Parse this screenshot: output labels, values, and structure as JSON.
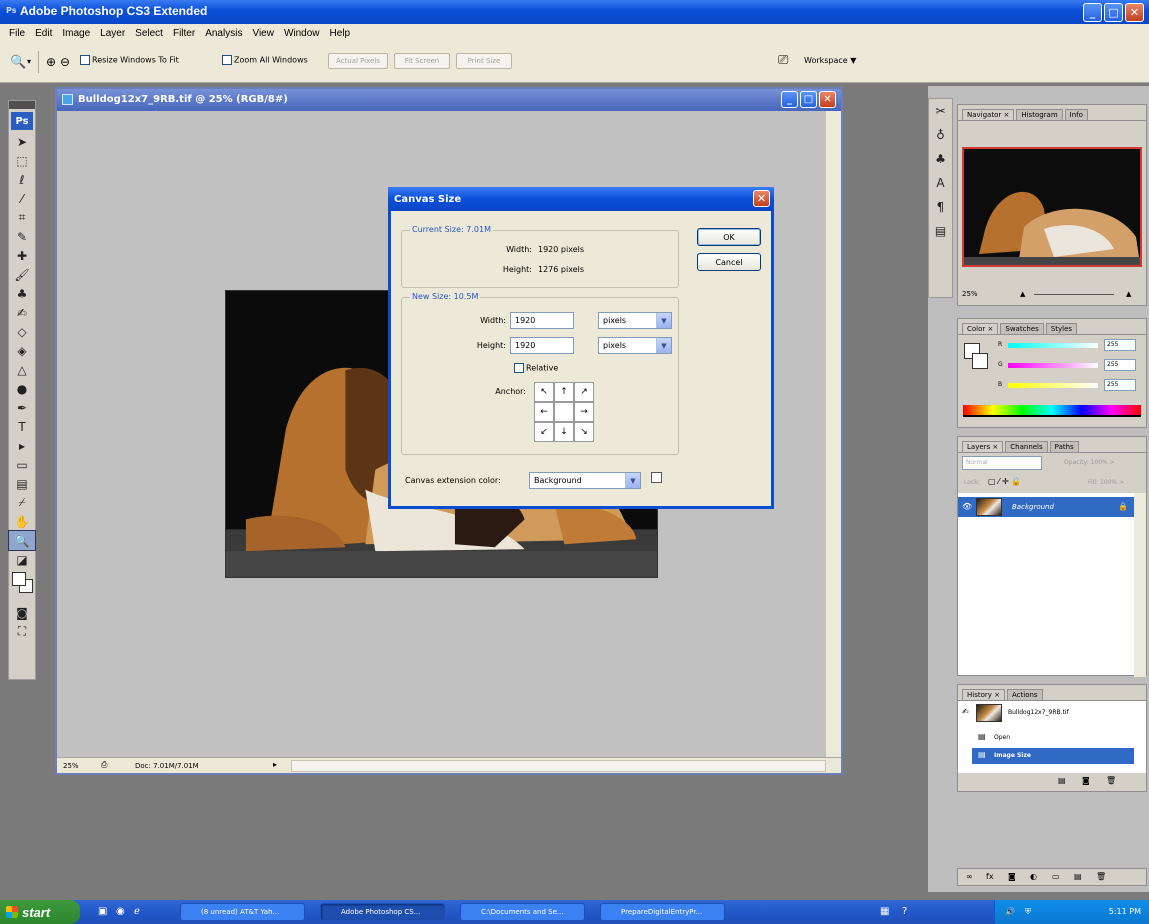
{
  "window": {
    "title": "Adobe Photoshop CS3 Extended",
    "min": "_",
    "max": "□",
    "close": "✕"
  },
  "menu": [
    "File",
    "Edit",
    "Image",
    "Layer",
    "Select",
    "Filter",
    "Analysis",
    "View",
    "Window",
    "Help"
  ],
  "options": {
    "resize_windows": "Resize Windows To Fit",
    "zoom_all": "Zoom All Windows",
    "actual_pixels": "Actual Pixels",
    "fit_screen": "Fit Screen",
    "print_size": "Print Size",
    "workspace": "Workspace ▼"
  },
  "document": {
    "title": "Bulldog12x7_9RB.tif @ 25% (RGB/8#)",
    "zoom": "25%",
    "doc_info": "Doc: 7.01M/7.01M"
  },
  "dialog": {
    "title": "Canvas Size",
    "current_legend": "Current Size: 7.01M",
    "current_width_label": "Width:",
    "current_width_value": "1920 pixels",
    "current_height_label": "Height:",
    "current_height_value": "1276 pixels",
    "new_legend": "New Size: 10.5M",
    "width_label": "Width:",
    "width_value": "1920",
    "width_unit": "pixels",
    "height_label": "Height:",
    "height_value": "1920",
    "height_unit": "pixels",
    "relative_label": "Relative",
    "anchor_label": "Anchor:",
    "ext_color_label": "Canvas extension color:",
    "ext_color_value": "Background",
    "ok": "OK",
    "cancel": "Cancel"
  },
  "panels": {
    "nav_tabs": [
      "Navigator ×",
      "Histogram",
      "Info"
    ],
    "nav_zoom": "25%",
    "color_tabs": [
      "Color ×",
      "Swatches",
      "Styles"
    ],
    "color_labels": [
      "R",
      "G",
      "B"
    ],
    "color_values": [
      "255",
      "255",
      "255"
    ],
    "layers_tabs": [
      "Layers ×",
      "Channels",
      "Paths"
    ],
    "blend_mode": "Normal",
    "opacity": "Opacity: 100% >",
    "lock_label": "Lock:",
    "fill": "Fill: 100% >",
    "layer_name": "Background",
    "history_tabs": [
      "History ×",
      "Actions"
    ],
    "history_snapshot": "Bulldog12x7_9RB.tif",
    "history_items": [
      "Open",
      "Image Size"
    ]
  },
  "taskbar": {
    "start": "start",
    "buttons": [
      "(8 unread) AT&T Yah...",
      "Adobe Photoshop CS...",
      "C:\\Documents and Se...",
      "PrepareDigitalEntryPr..."
    ],
    "clock": "5:11 PM"
  }
}
